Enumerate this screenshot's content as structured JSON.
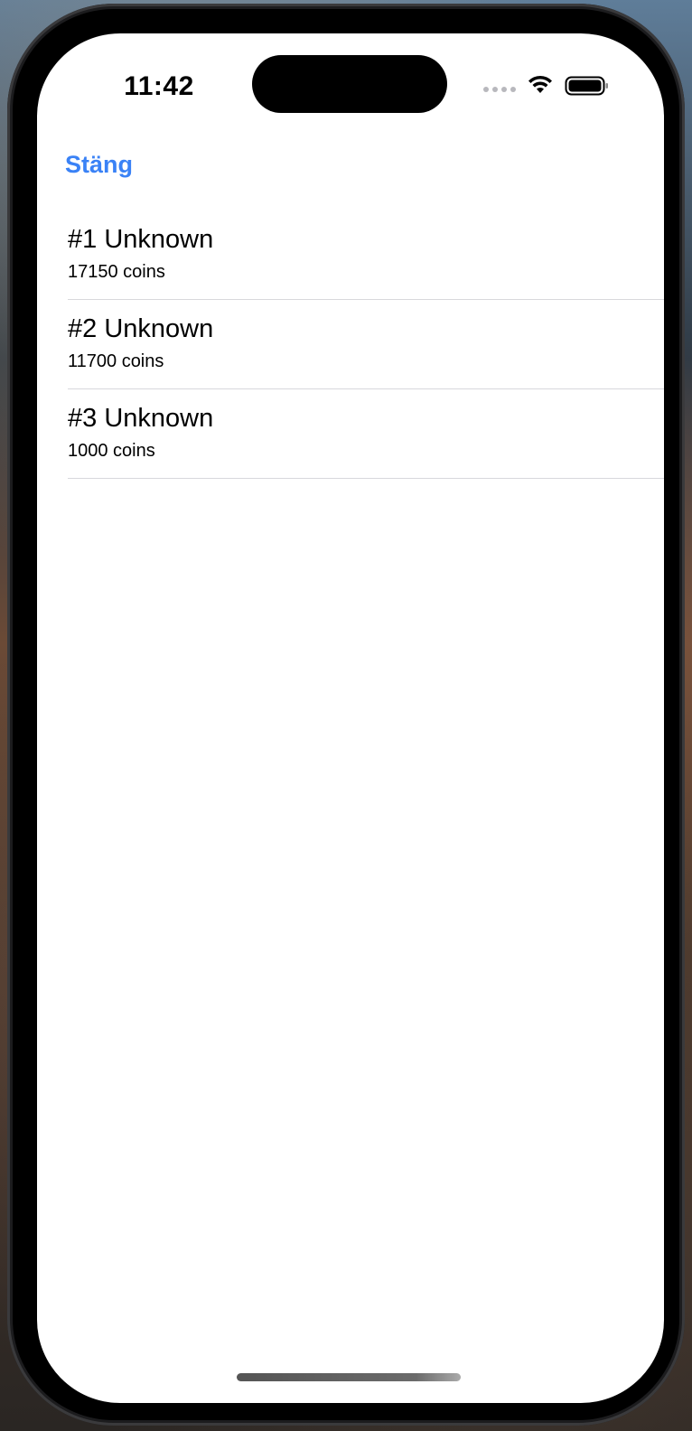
{
  "status_bar": {
    "time": "11:42",
    "icons": [
      "cellular-signal-icon",
      "wifi-icon",
      "battery-icon"
    ]
  },
  "nav": {
    "close_label": "Stäng"
  },
  "leaderboard": {
    "items": [
      {
        "title": "#1 Unknown",
        "subtitle": "17150 coins"
      },
      {
        "title": "#2 Unknown",
        "subtitle": "11700 coins"
      },
      {
        "title": "#3 Unknown",
        "subtitle": "1000 coins"
      }
    ]
  },
  "colors": {
    "accent": "#3a82f6",
    "background": "#ffffff",
    "separator": "#d8d8dc"
  }
}
